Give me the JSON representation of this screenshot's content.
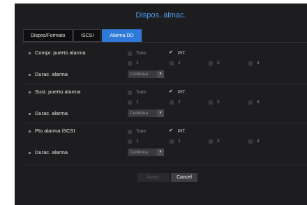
{
  "dialog": {
    "title": "Dispos. almac.",
    "tabs": [
      {
        "label": "Dispos/Formato",
        "active": false
      },
      {
        "label": "iSCSI",
        "active": false
      },
      {
        "label": "Alarma DD",
        "active": true
      }
    ],
    "sections": [
      {
        "port_label": "Compr. puerto alarma",
        "options": {
          "all": "Todo",
          "all_checked": false,
          "pit": "PIT.",
          "pit_checked": true,
          "n1": "1",
          "n2": "2",
          "n3": "3",
          "n4": "4"
        },
        "duration_label": "Durac. alarma",
        "duration_value": "Continua"
      },
      {
        "port_label": "Sust. puerto alarma",
        "options": {
          "all": "Todo",
          "all_checked": false,
          "pit": "PIT.",
          "pit_checked": true,
          "n1": "1",
          "n2": "2",
          "n3": "3",
          "n4": "4"
        },
        "duration_label": "Durac. alarma",
        "duration_value": "Continua"
      },
      {
        "port_label": "Pto alarma iSCSI",
        "options": {
          "all": "Todo",
          "all_checked": false,
          "pit": "PIT.",
          "pit_checked": true,
          "n1": "1",
          "n2": "2",
          "n3": "3",
          "n4": "4"
        },
        "duration_label": "Durac. alarma",
        "duration_value": "Continua"
      }
    ],
    "buttons": {
      "accept": "Acept.",
      "cancel": "Cancel"
    }
  }
}
